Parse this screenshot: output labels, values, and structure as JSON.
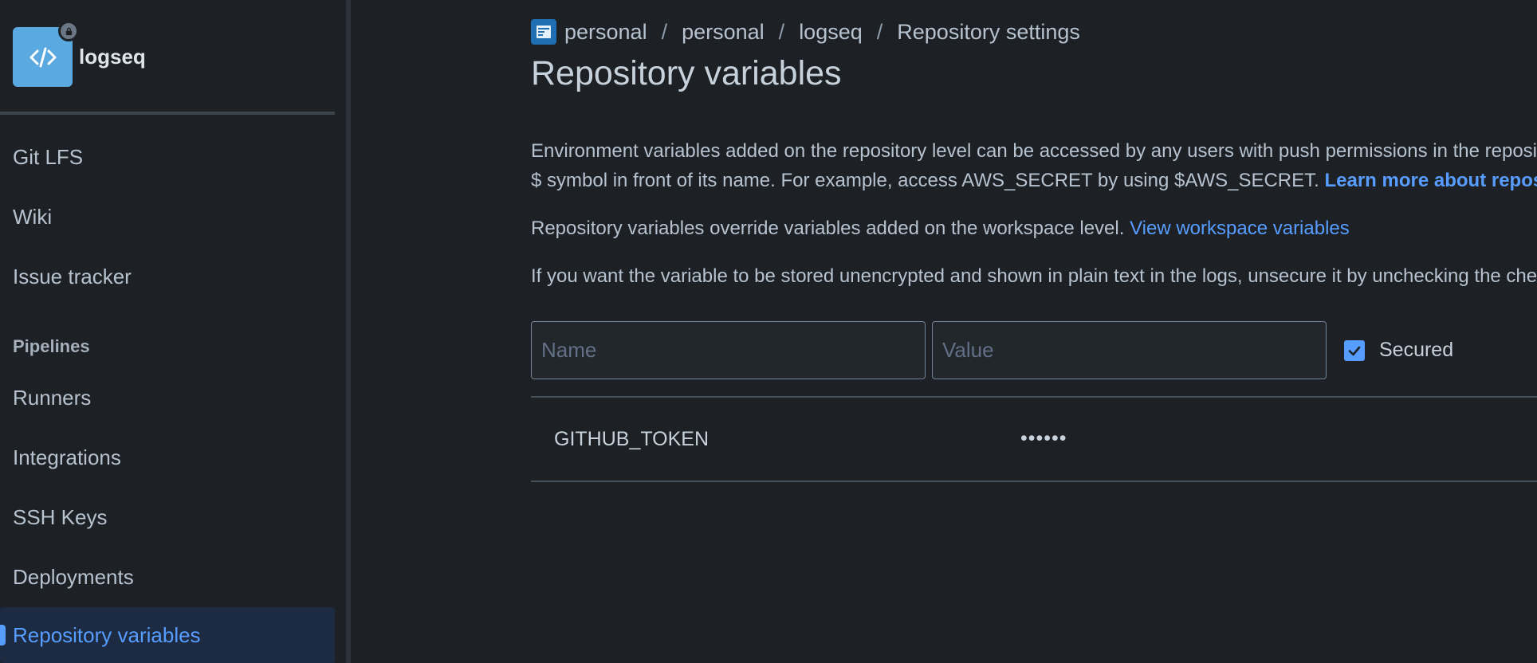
{
  "repo": {
    "name": "logseq"
  },
  "sidebar": {
    "items": [
      {
        "label": "Git LFS"
      },
      {
        "label": "Wiki"
      },
      {
        "label": "Issue tracker"
      }
    ],
    "pipelines_heading": "Pipelines",
    "pipeline_items": [
      {
        "label": "Runners"
      },
      {
        "label": "Integrations"
      },
      {
        "label": "SSH Keys"
      },
      {
        "label": "Deployments"
      },
      {
        "label": "Repository variables",
        "active": true
      }
    ]
  },
  "breadcrumb": [
    "personal",
    "personal",
    "logseq",
    "Repository settings"
  ],
  "breadcrumb_separator": "/",
  "page_title": "Repository variables",
  "description": {
    "line1": "Environment variables added on the repository level can be accessed by any users with push permissions in the repository. To access a variable, put the",
    "line2_text": "$ symbol in front of its name. For example, access AWS_SECRET by using $AWS_SECRET. ",
    "line2_link": "Learn more about repository variables",
    "override_text": "Repository variables override variables added on the workspace level. ",
    "override_link": "View workspace variables",
    "unsecure_text": "If you want the variable to be stored unencrypted and shown in plain text in the logs, unsecure it by unchecking the checkbox."
  },
  "form": {
    "name_placeholder": "Name",
    "value_placeholder": "Value",
    "secured_label": "Secured",
    "secured_checked": true
  },
  "variables": [
    {
      "name": "GITHUB_TOKEN",
      "value": "••••••"
    }
  ],
  "colors": {
    "accent": "#579dff",
    "background": "#1d2125",
    "avatar": "#5aa9e0"
  }
}
